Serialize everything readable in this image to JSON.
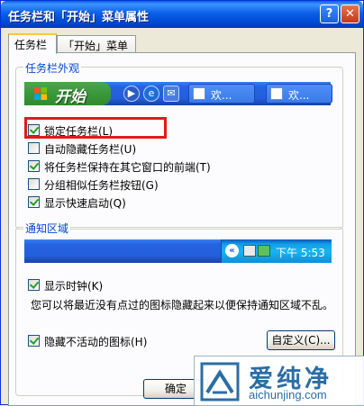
{
  "window": {
    "title": "任务栏和「开始」菜单属性",
    "help_glyph": "?",
    "close_glyph": "✕"
  },
  "tabs": [
    {
      "label": "任务栏",
      "active": true
    },
    {
      "label": "「开始」菜单",
      "active": false
    }
  ],
  "appearance_group": {
    "label": "任务栏外观",
    "taskbar_preview": {
      "start_label": "开始",
      "task_buttons": [
        {
          "label": "欢..."
        },
        {
          "label": "欢..."
        }
      ]
    },
    "options": [
      {
        "label": "锁定任务栏(L)",
        "checked": true
      },
      {
        "label": "自动隐藏任务栏(U)",
        "checked": false
      },
      {
        "label": "将任务栏保持在其它窗口的前端(T)",
        "checked": true
      },
      {
        "label": "分组相似任务栏按钮(G)",
        "checked": false
      },
      {
        "label": "显示快速启动(Q)",
        "checked": true
      }
    ]
  },
  "notification_group": {
    "label": "通知区域",
    "tray_preview": {
      "chevron": "«",
      "clock": "下午 5:53"
    },
    "show_clock": {
      "label": "显示时钟(K)",
      "checked": true
    },
    "description": "您可以将最近没有点过的图标隐藏起来以便保持通知区域不乱。",
    "hide_inactive": {
      "label": "隐藏不活动的图标(H)",
      "checked": true
    },
    "customize_label": "自定义(C)..."
  },
  "footer": {
    "ok_label": "确定"
  },
  "watermark": {
    "cn_text": "爱纯净",
    "url": "aichunjing.com"
  }
}
